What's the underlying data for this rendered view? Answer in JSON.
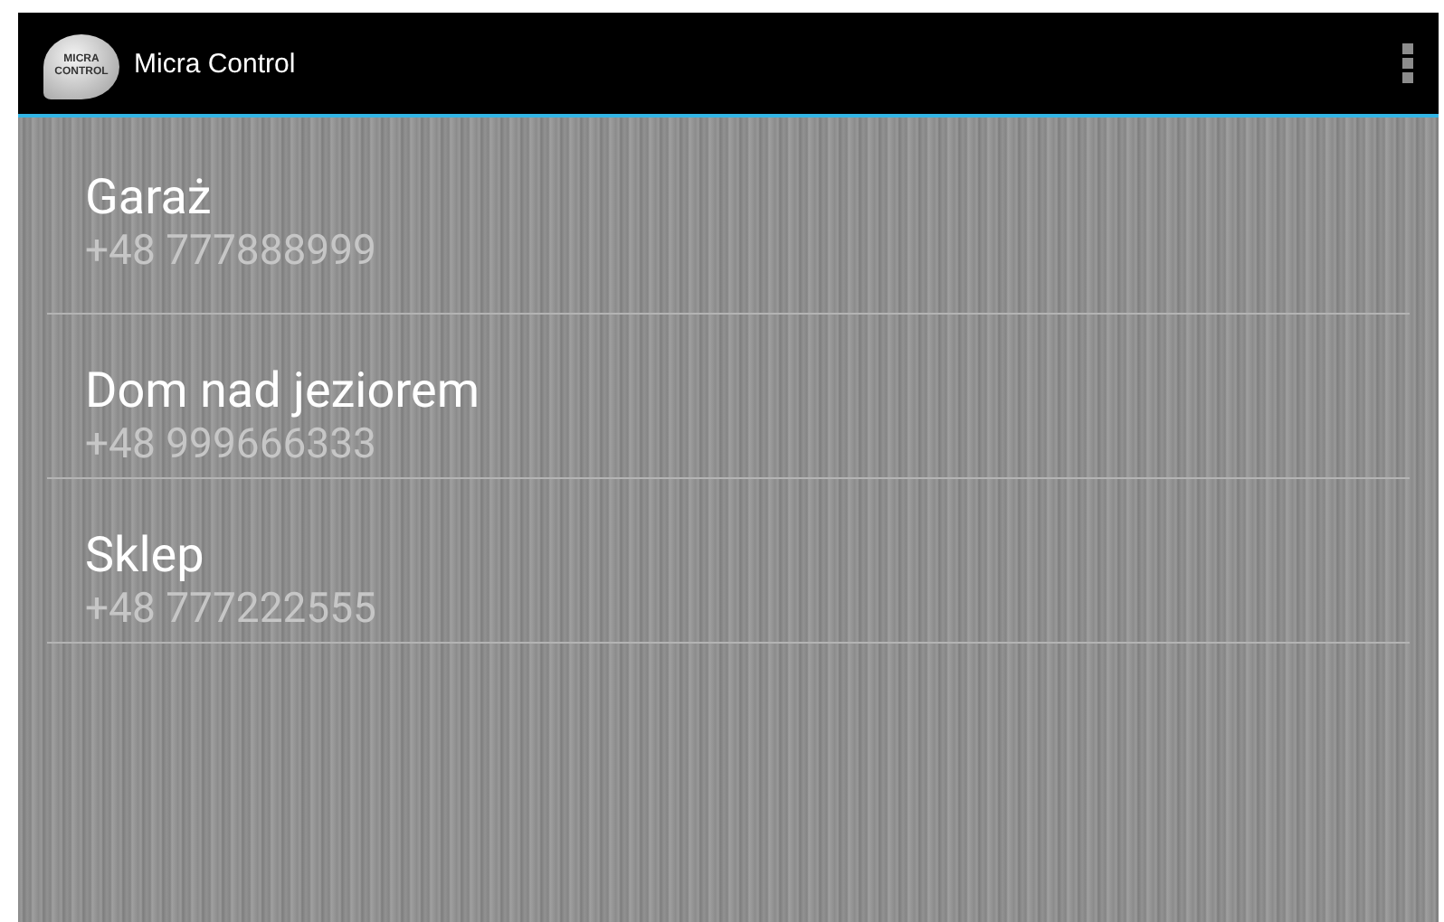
{
  "action_bar": {
    "logo_text": [
      "MICRA",
      "CONTROL"
    ],
    "title": "Micra Control"
  },
  "contacts": [
    {
      "name": "Garaż",
      "phone": "+48 777888999"
    },
    {
      "name": "Dom nad jeziorem",
      "phone": "+48 999666333"
    },
    {
      "name": "Sklep",
      "phone": "+48 777222555"
    }
  ]
}
